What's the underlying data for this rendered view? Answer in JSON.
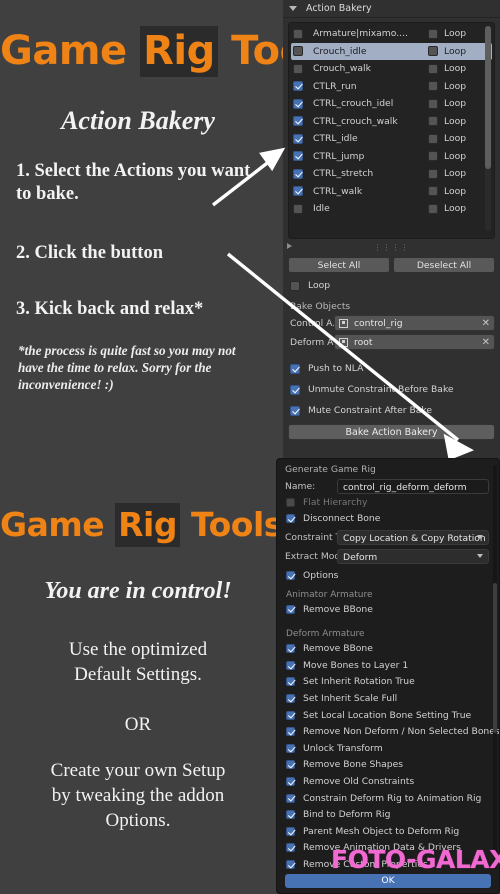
{
  "promo": {
    "logo_parts": [
      {
        "text": "Game ",
        "highlight": false
      },
      {
        "text": "Rig",
        "highlight": true
      },
      {
        "text": " Tools",
        "highlight": false
      }
    ],
    "logo_color": "#ef8316",
    "tagline_top": "Action Bakery",
    "tagline_bottom": "You are in control!",
    "steps": [
      "1. Select the Actions you want to bake.",
      "2. Click the button",
      "3. Kick back and relax*"
    ],
    "footnote": "*the process is quite fast so you may not have the time to relax. Sorry for the inconvenience! :)",
    "bottom_lines": [
      "Use the optimized\nDefault Settings.",
      "OR",
      "Create your own Setup\nby tweaking the addon\nOptions."
    ]
  },
  "panel": {
    "header": {
      "title": "Action Bakery",
      "disclosure_icon": "triangle-down-icon"
    },
    "action_list": {
      "loop_label": "Loop",
      "rows": [
        {
          "name": "Armature|mixamo....",
          "checked": false,
          "loop": false,
          "selected": false
        },
        {
          "name": "Crouch_idle",
          "checked": false,
          "loop": false,
          "selected": true
        },
        {
          "name": "Crouch_walk",
          "checked": false,
          "loop": false,
          "selected": false
        },
        {
          "name": "CTLR_run",
          "checked": true,
          "loop": false,
          "selected": false
        },
        {
          "name": "CTRL_crouch_idel",
          "checked": true,
          "loop": false,
          "selected": false
        },
        {
          "name": "CTRL_crouch_walk",
          "checked": true,
          "loop": false,
          "selected": false
        },
        {
          "name": "CTRL_idle",
          "checked": true,
          "loop": false,
          "selected": false
        },
        {
          "name": "CTRL_jump",
          "checked": true,
          "loop": false,
          "selected": false
        },
        {
          "name": "CTRL_stretch",
          "checked": true,
          "loop": false,
          "selected": false
        },
        {
          "name": "CTRL_walk",
          "checked": true,
          "loop": false,
          "selected": false
        },
        {
          "name": "Idle",
          "checked": false,
          "loop": false,
          "selected": false
        }
      ],
      "grip_glyph": "⣿",
      "expand_icon": "triangle-right-icon"
    },
    "select_all_label": "Select All",
    "deselect_all_label": "Deselect All",
    "loop_option": {
      "label": "Loop",
      "checked": false
    },
    "bake_objects_label": "Bake Objects",
    "fields": [
      {
        "key": "Control A...",
        "value": "control_rig",
        "icon": "object-icon",
        "clear_icon": "close-icon"
      },
      {
        "key": "Deform A...",
        "value": "root",
        "icon": "object-icon",
        "clear_icon": "close-icon"
      }
    ],
    "options": [
      {
        "label": "Push to NLA",
        "checked": true
      },
      {
        "label": "Unmute Constraint Before Bake",
        "checked": true
      },
      {
        "label": "Mute Constraint After Bake",
        "checked": true
      }
    ],
    "bake_button_label": "Bake Action Bakery"
  },
  "dialog": {
    "title": "Generate Game Rig",
    "name_key": "Name:",
    "name_value": "control_rig_deform_deform",
    "flat_hierarchy": {
      "label": "Flat Hierarchy",
      "checked": false
    },
    "disconnect_bone": {
      "label": "Disconnect Bone",
      "checked": true
    },
    "constraint_type": {
      "key": "Constraint Ty...",
      "value": "Copy Location & Copy Rotation"
    },
    "extract_mode": {
      "key": "Extract Mode:",
      "value": "Deform"
    },
    "options_toggle": {
      "label": "Options",
      "checked": true
    },
    "animator_armature_label": "Animator Armature",
    "animator_items": [
      {
        "label": "Remove BBone",
        "checked": true
      }
    ],
    "deform_armature_label": "Deform Armature",
    "deform_items": [
      {
        "label": "Remove BBone",
        "checked": true
      },
      {
        "label": "Move Bones to Layer 1",
        "checked": true
      },
      {
        "label": "Set Inherit Rotation True",
        "checked": true
      },
      {
        "label": "Set Inherit Scale Full",
        "checked": true
      },
      {
        "label": "Set Local Location Bone Setting True",
        "checked": true
      },
      {
        "label": "Remove Non Deform / Non Selected Bones",
        "checked": true
      },
      {
        "label": "Unlock Transform",
        "checked": true
      },
      {
        "label": "Remove Bone Shapes",
        "checked": true
      },
      {
        "label": "Remove Old Constraints",
        "checked": true
      },
      {
        "label": "Constrain Deform Rig to Animation Rig",
        "checked": true
      },
      {
        "label": "Bind to Deform Rig",
        "checked": true
      },
      {
        "label": "Parent Mesh Object to Deform Rig",
        "checked": true
      },
      {
        "label": "Remove Animation Data & Drivers",
        "checked": true
      },
      {
        "label": "Remove Custom Properties",
        "checked": true
      }
    ],
    "ok_label": "OK",
    "accent_color": "#4772b3"
  },
  "watermark": {
    "text": "FOTO-GALAXY",
    "color": "#f06ad2"
  }
}
